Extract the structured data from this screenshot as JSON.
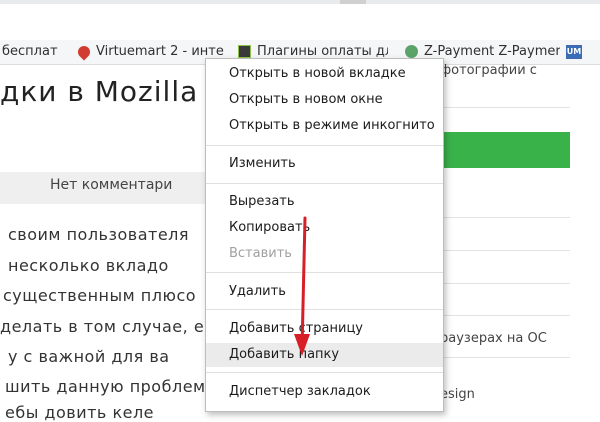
{
  "bookmarks": [
    {
      "label": "бесплат",
      "icon": "none"
    },
    {
      "label": "Virtuemart 2 - инте",
      "icon": "map-pin-icon"
    },
    {
      "label": "Плагины оплаты дл",
      "icon": "plugin-icon"
    },
    {
      "label": "Z-Payment Z-Paymer",
      "icon": "zpayment-icon"
    },
    {
      "label": "UM",
      "icon": "um-icon"
    }
  ],
  "page": {
    "heading": "дки в Mozilla",
    "comments": "Нет комментари",
    "paragraph": [
      "своим пользователя",
      "несколько вкладо",
      "существенным плюсо",
      "делать в том случае, есл",
      "у с важной для ва",
      "шить данную проблем",
      "ебы довить келе"
    ],
    "right_texts": [
      "фотографии с",
      "раузерах на ОС",
      "esign"
    ]
  },
  "context_menu": {
    "items": [
      {
        "label": "Открыть в новой вкладке",
        "enabled": true
      },
      {
        "label": "Открыть в новом окне",
        "enabled": true
      },
      {
        "label": "Открыть в режиме инкогнито",
        "enabled": true
      },
      {
        "label": "Изменить",
        "enabled": true
      },
      {
        "label": "Вырезать",
        "enabled": true
      },
      {
        "label": "Копировать",
        "enabled": true
      },
      {
        "label": "Вставить",
        "enabled": false
      },
      {
        "label": "Удалить",
        "enabled": true
      },
      {
        "label": "Добавить страницу",
        "enabled": true
      },
      {
        "label": "Добавить папку",
        "enabled": true,
        "highlighted": true
      },
      {
        "label": "Диспетчер закладок",
        "enabled": true
      }
    ]
  },
  "colors": {
    "accent_green": "#3ab24a",
    "annotation_arrow": "#d61f26"
  }
}
